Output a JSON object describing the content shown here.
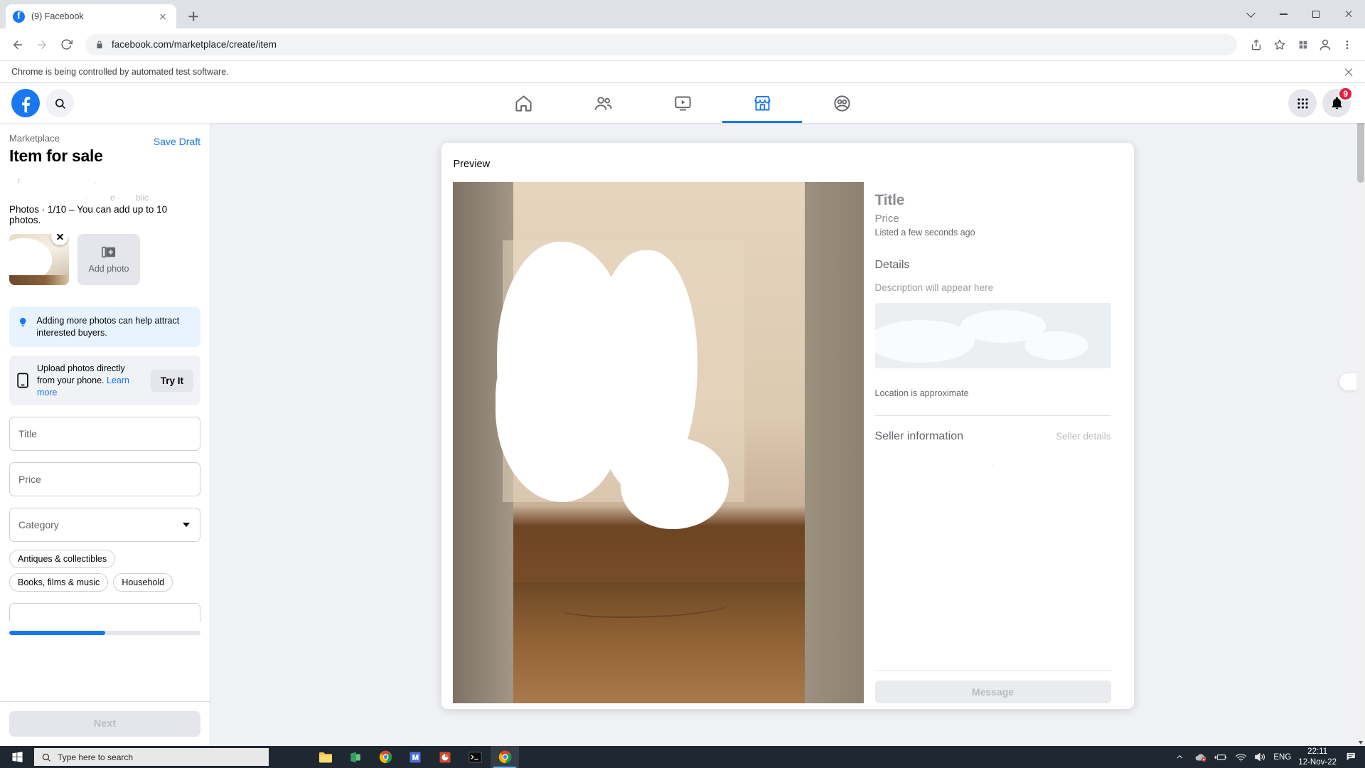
{
  "browser": {
    "tab": {
      "title": "(9) Facebook",
      "favicon": "facebook-icon"
    },
    "url": "facebook.com/marketplace/create/item",
    "infobar": "Chrome is being controlled by automated test software."
  },
  "fbnav": {
    "tabs": [
      {
        "name": "home",
        "icon": "home-icon",
        "active": false
      },
      {
        "name": "friends",
        "icon": "friends-icon",
        "active": false
      },
      {
        "name": "watch",
        "icon": "watch-icon",
        "active": false
      },
      {
        "name": "marketplace",
        "icon": "marketplace-icon",
        "active": true
      },
      {
        "name": "groups",
        "icon": "groups-icon",
        "active": false
      }
    ],
    "notifications_count": "9"
  },
  "sidebar": {
    "breadcrumb": "Marketplace",
    "title": "Item for sale",
    "save_draft": "Save Draft",
    "ghost_line_1": "r",
    "ghost_line_2": "·",
    "ghost_line_3a": "·",
    "ghost_line_3b": "e ·",
    "ghost_line_3c": "blic",
    "photos_label": "Photos · 1/10 – You can add up to 10 photos.",
    "add_photo_label": "Add photo",
    "tip_text": "Adding more photos can help attract interested buyers.",
    "phone_text": "Upload photos directly from your phone.",
    "phone_link": "Learn more",
    "try_it": "Try It",
    "fields": {
      "title": "Title",
      "price": "Price",
      "category": "Category"
    },
    "category_chips": [
      "Antiques & collectibles",
      "Books, films & music",
      "Household"
    ],
    "progress_percent": 50,
    "next_label": "Next"
  },
  "preview": {
    "header": "Preview",
    "title": "Title",
    "price": "Price",
    "listed": "Listed a few seconds ago",
    "details_heading": "Details",
    "description_placeholder": "Description will appear here",
    "location_note": "Location is approximate",
    "seller_heading": "Seller information",
    "seller_details_link": "Seller details",
    "seller_ghost": "·",
    "message_label": "Message"
  },
  "taskbar": {
    "search_placeholder": "Type here to search",
    "language": "ENG",
    "time": "22:11",
    "date": "12-Nov-22",
    "apps": [
      {
        "name": "file-explorer",
        "active": false
      },
      {
        "name": "office-app",
        "active": false
      },
      {
        "name": "chrome-taskbar",
        "active": false
      },
      {
        "name": "editor-app",
        "active": false
      },
      {
        "name": "presentation-app",
        "active": false
      },
      {
        "name": "terminal-app",
        "active": false
      },
      {
        "name": "chrome-window",
        "active": true
      }
    ]
  },
  "colors": {
    "fb_blue": "#1877f2",
    "badge_red": "#e41e3f"
  }
}
